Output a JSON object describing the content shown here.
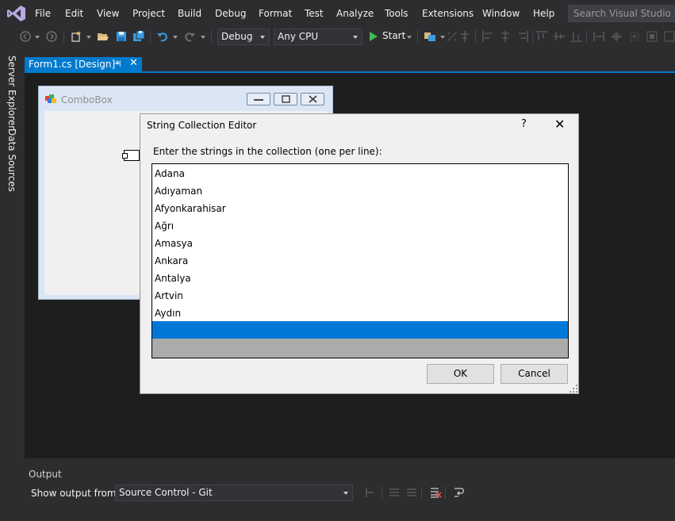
{
  "menu": {
    "items": [
      "File",
      "Edit",
      "View",
      "Project",
      "Build",
      "Debug",
      "Format",
      "Test",
      "Analyze",
      "Tools",
      "Extensions",
      "Window",
      "Help"
    ],
    "search_placeholder": "Search Visual Studio (Ctrl+Q)"
  },
  "toolbar": {
    "configuration": "Debug",
    "platform": "Any CPU",
    "start_label": "Start"
  },
  "side_tabs": {
    "server_explorer": "Server Explorer",
    "data_sources": "Data Sources"
  },
  "document_tab": {
    "title": "Form1.cs [Design]*",
    "pin_glyph": "⊣",
    "close_glyph": "✕"
  },
  "form": {
    "title": "ComboBox"
  },
  "dialog": {
    "title": "String Collection Editor",
    "help_glyph": "?",
    "close_glyph": "✕",
    "instruction": "Enter the strings in the collection (one per line):",
    "lines": [
      "Adana",
      "Adıyaman",
      "Afyonkarahisar",
      "Ağrı",
      "Amasya",
      "Ankara",
      "Antalya",
      "Artvin",
      "Aydın"
    ],
    "ok_label": "OK",
    "cancel_label": "Cancel"
  },
  "output": {
    "title": "Output",
    "show_from_label": "Show output from:",
    "source": "Source Control - Git"
  },
  "colors": {
    "accent": "#007acc",
    "selection": "#0078d7",
    "ide_background": "#2d2d30",
    "designer_background": "#1e1e1e",
    "start_green": "#3fb950"
  }
}
